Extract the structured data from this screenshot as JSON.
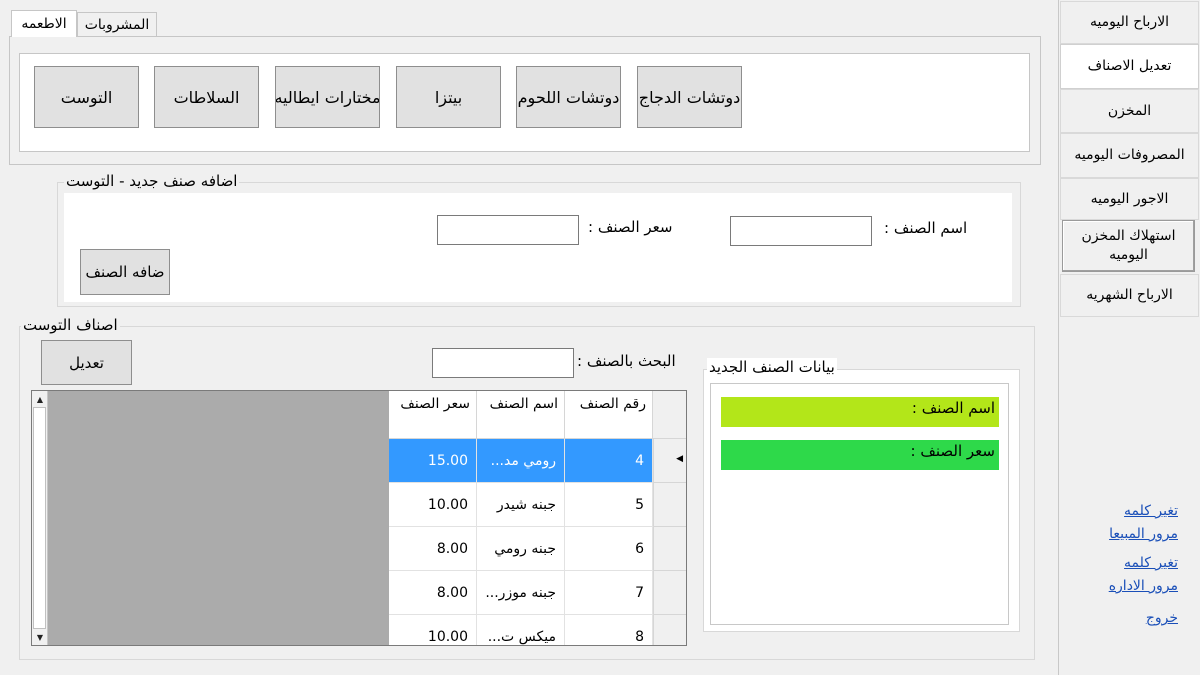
{
  "nav": {
    "items": [
      {
        "label": "الارباح اليوميه"
      },
      {
        "label": "تعديل الاصناف"
      },
      {
        "label": "المخزن"
      },
      {
        "label": "المصروفات اليوميه"
      },
      {
        "label": "الاجور اليوميه"
      },
      {
        "label": "استهلاك المخزن اليوميه"
      },
      {
        "label": "الارباح الشهريه"
      }
    ],
    "links": [
      {
        "label": "تغير كلمه\nمرور  المبيعا"
      },
      {
        "label": "تغير كلمه\nمرور  الاداره"
      },
      {
        "label": "خروج"
      }
    ]
  },
  "tabs": [
    {
      "label": "الاطعمه"
    },
    {
      "label": "المشروبات"
    }
  ],
  "categories": [
    "دوتشات الدجاج",
    "دوتشات اللحوم",
    "بيتزا",
    "مختارات ايطاليه",
    "السلاطات",
    "التوست"
  ],
  "add_form": {
    "title": "اضافه صنف جديد - التوست",
    "name_label": "اسم الصنف :",
    "price_label": "سعر الصنف :",
    "name_value": "",
    "price_value": "",
    "add_button": "ضافه الصنف"
  },
  "list_section": {
    "title": "اصناف التوست",
    "search_label": "البحث بالصنف :",
    "search_value": "",
    "edit_button": "تعديل"
  },
  "grid": {
    "columns": [
      "رقم الصنف",
      "اسم الصنف",
      "سعر الصنف"
    ],
    "rows": [
      {
        "id": "4",
        "name": "رومي مد...",
        "price": "15.00",
        "selected": true
      },
      {
        "id": "5",
        "name": "جبنه شيدر",
        "price": "10.00"
      },
      {
        "id": "6",
        "name": "جبنه رومي",
        "price": "8.00"
      },
      {
        "id": "7",
        "name": "جبنه موزر...",
        "price": "8.00"
      },
      {
        "id": "8",
        "name": "ميكس ت...",
        "price": "10.00"
      }
    ]
  },
  "new_item_panel": {
    "title": "بيانات الصنف الجديد",
    "name_label": "اسم الصنف :",
    "price_label": "سعر الصنف :",
    "name_bar_color": "#b3e619",
    "price_bar_color": "#2ed94a"
  },
  "colors": {
    "selection": "#3399ff",
    "link": "#1a4fb8"
  }
}
